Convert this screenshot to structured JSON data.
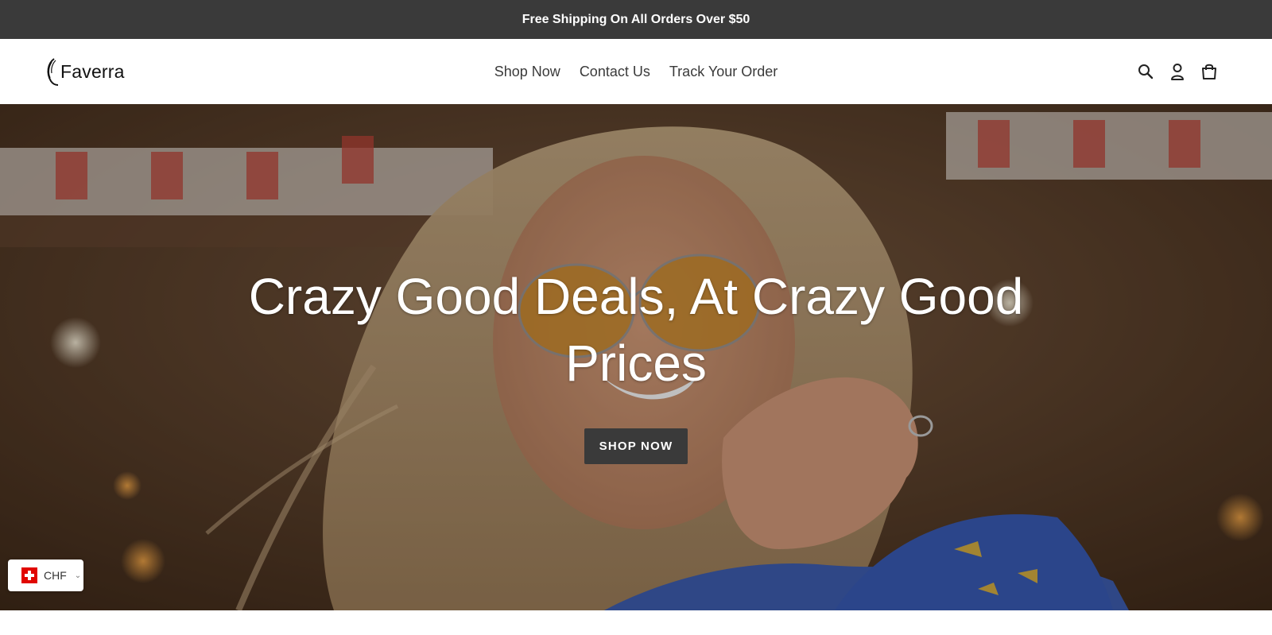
{
  "announcement": {
    "text": "Free Shipping On All Orders Over $50"
  },
  "header": {
    "logo_text": "Faverra",
    "nav": [
      {
        "label": "Shop Now"
      },
      {
        "label": "Contact Us"
      },
      {
        "label": "Track Your Order"
      }
    ],
    "icons": [
      "search-icon",
      "account-icon",
      "cart-icon"
    ]
  },
  "hero": {
    "title": "Crazy Good Deals, At Crazy Good Prices",
    "button_label": "SHOP NOW"
  },
  "currency_selector": {
    "flag_icon": "switzerland-flag-icon",
    "code": "CHF"
  },
  "colors": {
    "announcement_bg": "#3a3a3a",
    "button_bg": "#3a3a3a",
    "nav_text": "#3a3a3a"
  }
}
